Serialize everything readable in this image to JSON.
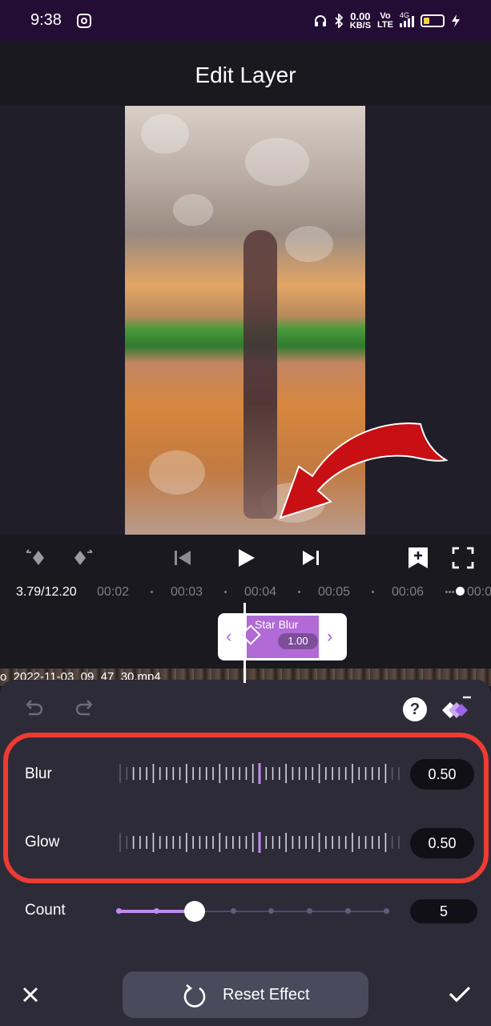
{
  "status_bar": {
    "time": "9:38",
    "speed_value": "0.00",
    "speed_unit": "KB/S",
    "volte_line1": "Vo",
    "volte_line2": "LTE",
    "network": "4G"
  },
  "header": {
    "title": "Edit Layer"
  },
  "timeline": {
    "time_readout": "3.79/12.20",
    "ticks": [
      "00:02",
      "00:03",
      "00:04",
      "00:05",
      "00:06",
      "00:0"
    ],
    "clip_label": "Star Blur",
    "clip_value": "1.00",
    "source_file": "o_2022-11-03_09_47_30.mp4"
  },
  "panel": {
    "help_label": "?",
    "params": [
      {
        "label": "Blur",
        "value": "0.50",
        "level": 0.5
      },
      {
        "label": "Glow",
        "value": "0.50",
        "level": 0.5
      }
    ],
    "count": {
      "label": "Count",
      "value": "5",
      "steps": 8,
      "selected_index": 2
    },
    "reset_label": "Reset Effect"
  },
  "colors": {
    "accent": "#c08cf0",
    "clip": "#b16ad6",
    "highlight": "#ef3b32",
    "panel_bg": "#2d2b38"
  },
  "icons": {
    "prev_keyframe": "diamond-left-icon",
    "next_keyframe": "diamond-right-icon",
    "skip_start": "skip-start-icon",
    "play": "play-icon",
    "skip_end": "skip-end-icon",
    "add_keyframe": "bookmark-plus-icon",
    "fullscreen": "fullscreen-icon",
    "undo": "undo-icon",
    "redo": "redo-icon",
    "help": "help-icon",
    "layers": "layers-icon",
    "close": "close-icon",
    "reset": "refresh-icon",
    "confirm": "check-icon"
  }
}
